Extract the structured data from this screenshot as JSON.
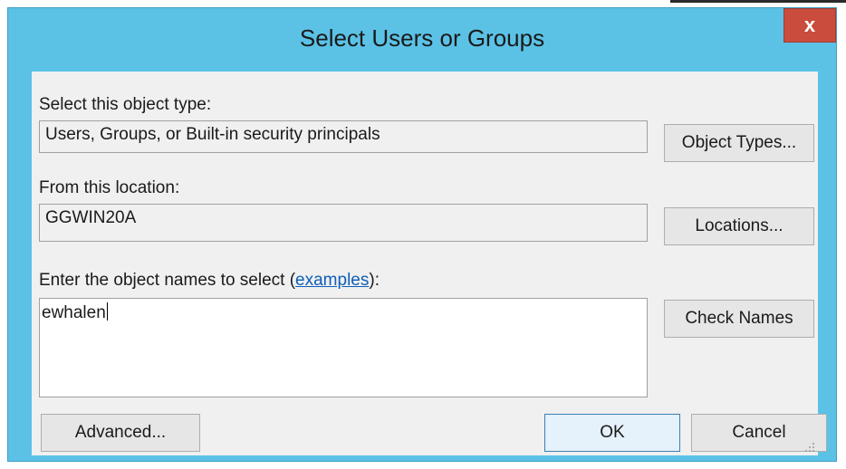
{
  "dialog": {
    "title": "Select Users or Groups",
    "close_glyph": "x"
  },
  "object_type": {
    "label": "Select this object type:",
    "value": "Users, Groups, or Built-in security principals",
    "button": "Object Types..."
  },
  "location": {
    "label": "From this location:",
    "value": "GGWIN20A",
    "button": "Locations..."
  },
  "names": {
    "label_prefix": "Enter the object names to select (",
    "link": "examples",
    "label_suffix": "):",
    "value": "ewhalen",
    "button": "Check Names"
  },
  "footer": {
    "advanced": "Advanced...",
    "ok": "OK",
    "cancel": "Cancel"
  }
}
